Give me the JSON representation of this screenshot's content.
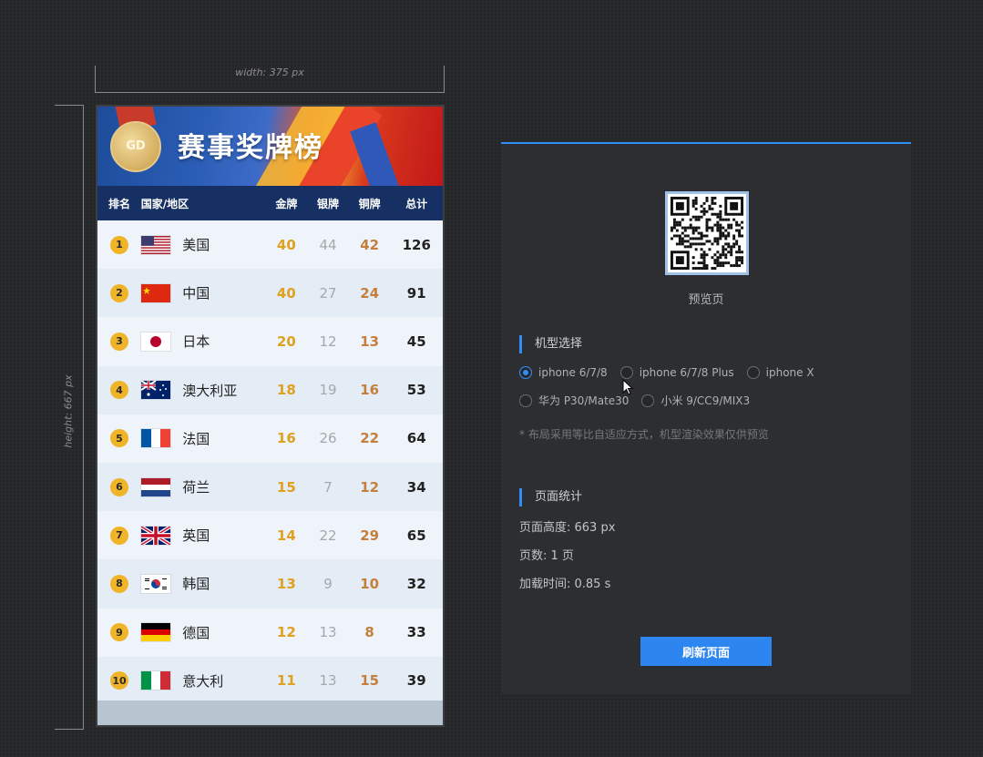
{
  "guides": {
    "width_label": "width: 375 px",
    "height_label": "height: 667 px"
  },
  "banner": {
    "title": "赛事奖牌榜",
    "medal_text": "GD"
  },
  "table": {
    "headers": [
      "排名",
      "国家/地区",
      "金牌",
      "银牌",
      "铜牌",
      "总计"
    ],
    "rows": [
      {
        "rank": "1",
        "country": "美国",
        "flag": "us-flag",
        "gold": "40",
        "silver": "44",
        "bronze": "42",
        "total": "126"
      },
      {
        "rank": "2",
        "country": "中国",
        "flag": "china-flag",
        "gold": "40",
        "silver": "27",
        "bronze": "24",
        "total": "91"
      },
      {
        "rank": "3",
        "country": "日本",
        "flag": "japan-flag",
        "gold": "20",
        "silver": "12",
        "bronze": "13",
        "total": "45"
      },
      {
        "rank": "4",
        "country": "澳大利亚",
        "flag": "australia-flag",
        "gold": "18",
        "silver": "19",
        "bronze": "16",
        "total": "53"
      },
      {
        "rank": "5",
        "country": "法国",
        "flag": "france-flag",
        "gold": "16",
        "silver": "26",
        "bronze": "22",
        "total": "64"
      },
      {
        "rank": "6",
        "country": "荷兰",
        "flag": "netherlands-flag",
        "gold": "15",
        "silver": "7",
        "bronze": "12",
        "total": "34"
      },
      {
        "rank": "7",
        "country": "英国",
        "flag": "uk-flag",
        "gold": "14",
        "silver": "22",
        "bronze": "29",
        "total": "65"
      },
      {
        "rank": "8",
        "country": "韩国",
        "flag": "korea-flag",
        "gold": "13",
        "silver": "9",
        "bronze": "10",
        "total": "32"
      },
      {
        "rank": "9",
        "country": "德国",
        "flag": "germany-flag",
        "gold": "12",
        "silver": "13",
        "bronze": "8",
        "total": "33"
      },
      {
        "rank": "10",
        "country": "意大利",
        "flag": "italy-flag",
        "gold": "11",
        "silver": "13",
        "bronze": "15",
        "total": "39"
      }
    ]
  },
  "panel": {
    "qr_label": "预览页",
    "device_title": "机型选择",
    "devices": [
      {
        "label": "iphone 6/7/8",
        "checked": true
      },
      {
        "label": "iphone 6/7/8 Plus",
        "checked": false
      },
      {
        "label": "iphone X",
        "checked": false
      },
      {
        "label": "华为 P30/Mate30",
        "checked": false
      },
      {
        "label": "小米 9/CC9/MIX3",
        "checked": false
      }
    ],
    "note": "* 布局采用等比自适应方式，机型渲染效果仅供预览",
    "stats_title": "页面统计",
    "stats": [
      "页面高度: 663 px",
      "页数: 1 页",
      "加载时间: 0.85 s"
    ],
    "refresh_label": "刷新页面"
  },
  "colors": {
    "accent": "#2f8df5",
    "gold": "#e0a020",
    "silver": "#a3a8ad",
    "bronze": "#c57f3d",
    "header_bg": "#163063"
  }
}
